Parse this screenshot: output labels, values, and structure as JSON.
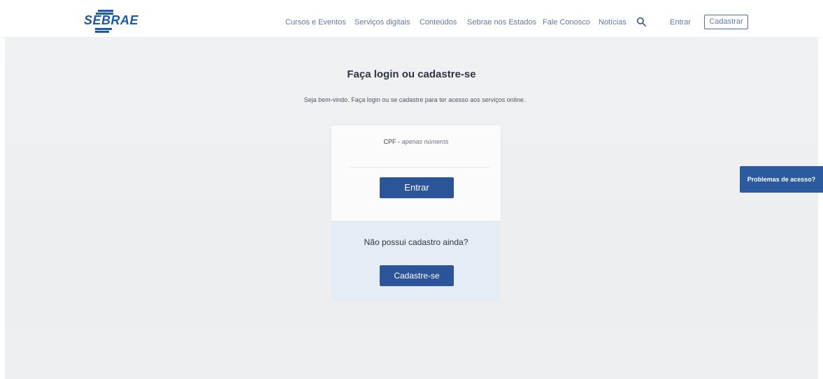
{
  "header": {
    "logo_text": "SEBRAE",
    "nav": [
      {
        "label": "Cursos e Eventos"
      },
      {
        "label": "Serviços digitais"
      },
      {
        "label": "Conteúdos"
      },
      {
        "label": "Sebrae nos Estados"
      },
      {
        "label": "Fale Conosco"
      },
      {
        "label": "Notícias"
      }
    ],
    "search_icon": "search-icon",
    "login_label": "Entrar",
    "register_label": "Cadastrar"
  },
  "main": {
    "title": "Faça login ou cadastre-se",
    "subtitle": "Seja bem-vindo. Faça login ou se cadastre para ter acesso aos serviços online.",
    "login_card": {
      "field_label": "CPF - ",
      "field_hint": "apenas números",
      "field_value": "",
      "submit_label": "Entrar"
    },
    "register_card": {
      "prompt": "Não possui cadastro ainda?",
      "button_label": "Cadastre-se"
    }
  },
  "help_tab": {
    "label": "Problemas de acesso?"
  },
  "colors": {
    "brand": "#1d5aa6",
    "button": "#2c5599",
    "nav_text": "#5f79a8",
    "backdrop": "#eeeff1"
  }
}
